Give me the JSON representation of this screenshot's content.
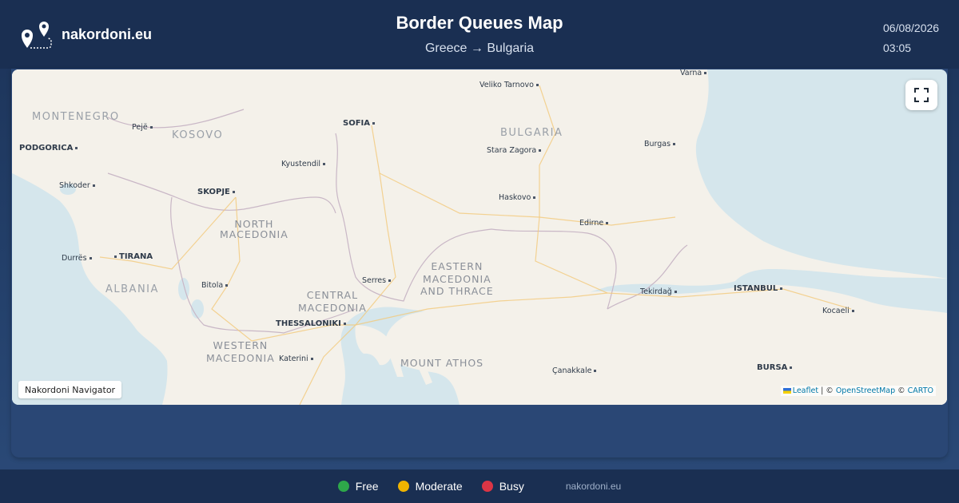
{
  "header": {
    "brand": "nakordoni.eu",
    "title": "Border Queues Map",
    "route": "Greece → Bulgaria",
    "date": "06/08/2026",
    "time": "03:05"
  },
  "map": {
    "labels": {
      "montenegro": "MONTENEGRO",
      "kosovo": "KOSOVO",
      "bulgaria": "BULGARIA",
      "north_macedonia": "NORTH\nMACEDONIA",
      "albania": "ALBANIA",
      "eastern_macedonia": "EASTERN\nMACEDONIA\nAND THRACE",
      "central_macedonia": "CENTRAL\nMACEDONIA",
      "western_macedonia": "WESTERN\nMACEDONIA",
      "mount_athos": "MOUNT ATHOS",
      "veliko_tarnovo": "Veliko Tarnovo",
      "varna": "Varna",
      "pejë": "Pejë",
      "podgorica": "PODGORICA",
      "sofia": "SOFIA",
      "stara_zagora": "Stara Zagora",
      "burgas": "Burgas",
      "kyustendil": "Kyustendil",
      "shkoder": "Shkoder",
      "skopje": "SKOPJE",
      "haskovo": "Haskovo",
      "edirne": "Edirne",
      "durres": "Durrës",
      "tirana": "TIRANA",
      "bitola": "Bitola",
      "serres": "Serres",
      "tekirdag": "Tekirdağ",
      "istanbul": "ISTANBUL",
      "thessaloniki": "THESSALONIKI",
      "kocaeli": "Kocaeli",
      "katerini": "Katerini",
      "canakkale": "Çanakkale",
      "bursa": "BURSA"
    },
    "navigator_badge": "Nakordoni Navigator",
    "attribution": {
      "leaflet": "Leaflet",
      "sep1": " | © ",
      "osm": "OpenStreetMap",
      "sep2": " © ",
      "carto": "CARTO"
    },
    "fullscreen_icon": "fullscreen-icon"
  },
  "legend": {
    "items": [
      {
        "label": "Free",
        "color": "#2ea84a"
      },
      {
        "label": "Moderate",
        "color": "#f0b400"
      },
      {
        "label": "Busy",
        "color": "#dc3545"
      }
    ],
    "site": "nakordoni.eu"
  },
  "colors": {
    "header_bg": "#1a2f52",
    "land": "#f4f1ea",
    "sea": "#d5e6ec"
  }
}
